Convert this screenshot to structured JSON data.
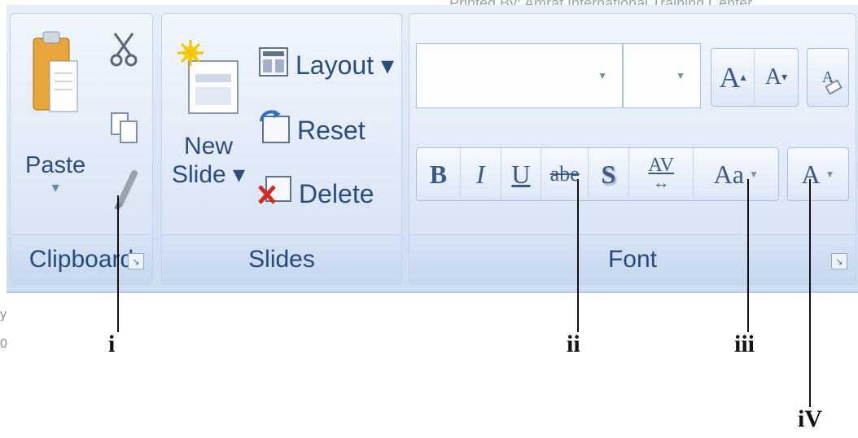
{
  "watermark": "Printed By: Amraf International Training Center",
  "side_fragments": [
    "y",
    "0"
  ],
  "clipboard": {
    "paste_label": "Paste",
    "paste_arrow": "▾",
    "group_label": "Clipboard",
    "icons": [
      "paste-icon",
      "cut-icon",
      "copy-icon",
      "format-painter-icon"
    ]
  },
  "slides": {
    "new_slide_label_1": "New",
    "new_slide_label_2": "Slide ▾",
    "layout_label": "Layout ▾",
    "reset_label": "Reset",
    "delete_label": "Delete",
    "group_label": "Slides"
  },
  "font": {
    "font_name_value": "",
    "font_size_value": "",
    "grow_label": "A",
    "shrink_label": "A",
    "clear_label": "A",
    "bold": "B",
    "italic": "I",
    "underline": "U",
    "strike": "abe",
    "shadow": "S",
    "spacing": "AV",
    "change_case": "Aa",
    "font_color": "A",
    "group_label": "Font"
  },
  "markers": [
    "i",
    "ii",
    "iii",
    "iV"
  ],
  "colors": {
    "ribbon": "#dfe9f7",
    "label_text": "#274a7a",
    "leader": "#111111"
  }
}
